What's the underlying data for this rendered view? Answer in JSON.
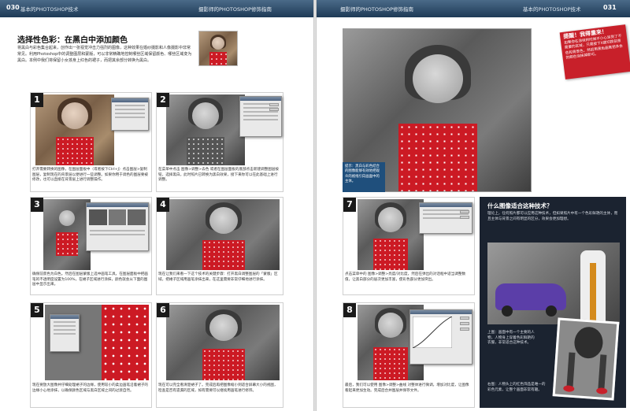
{
  "left_page": {
    "page_number": "030",
    "section": "基本的PHOTOSHOP技术",
    "running_title": "摄影师的PHOTOSHOP修饰指南",
    "title": "选择性色彩：在黑白中添加颜色",
    "intro": "将黑白与彩色集合起来，创作出一张视觉冲击力强烈的图像，这种效果在婚纱摄影和人像摄影中非常常见。利用Photoshop中的调整图层和蒙版，可以非常精确地控制哪些区域保留颜色、哪些区域变为黑白。本例中我们将保留小女孩身上红色的裙子，而把其余部分转换为黑白。",
    "steps": [
      {
        "n": "1",
        "text": "打开需要转换的图像，在图层面板中（或者按下Ctrl+J）点击图层>复制图层，复制现在的背景层以便进行一些调整。如果你用于调色的图层要被修改，也可以直接在背景层上进行调整操作。"
      },
      {
        "n": "2",
        "text": "在菜单中点击 图像>调整>去色 或者在图层面板的底部点击新建调整图层按钮，选择黑白。此时照片已转换为黑白效果，接下来你可以在此基础上进行调整。"
      },
      {
        "n": "3",
        "text": "确保前景色为白色。然后在图层蒙版上选中画笔工具，在图层面板中把画笔的不透明度设置为100%，在裙子区域进行涂抹，颜色就会从下面的图层中显示出来。"
      },
      {
        "n": "4",
        "text": "现在让我们来看一下这个技术的关键步骤：打开黑白调整图层的「蒙版」区域，把裙子区域用画笔涂抹出来，在这里需要非常仔细地进行涂抹。"
      },
      {
        "n": "5",
        "text": "现在要放大图像并仔细处理裙子的边缘，使用较小的柔边画笔沿着裙子的边缘小心地涂抹，以确保颜色区域与黑白区域之间的过渡自然。"
      },
      {
        "n": "6",
        "text": "现在可以完全看清楚裙子了。完成后再把图像缩小到适合屏幕大小的视图，检查是否有遗漏的区域，如有需要可以继续用画笔进行修饰。"
      }
    ]
  },
  "right_page": {
    "page_number": "031",
    "section": "基本的PHOTOSHOP技术",
    "running_title": "摄影师的PHOTOSHOP修饰指南",
    "warning_title": "提醒！我得重来！",
    "warning_text": "如果你在涂抹的时候不小心涂到了不需要的区域，只需按下X键切换前景色和背景色，然后用黑色画笔把多余的颜色涂抹掉即可。",
    "blue_note": "提示：黑白与彩色结合的图像能够有效地把观众的视线引向画面中的主体。",
    "steps": [
      {
        "n": "7",
        "text": "点击菜单中的 图像>调整>亮度/对比度，然后在弹出的对话框中适当调整数值，让黑白部分的层次更加丰富，使彩色部分更加突出。"
      },
      {
        "n": "8",
        "text": "最后，我们可以使用 图像>调整>曲线 对整体进行微调，增加对比度，让图像看起来更加生动。完成后合并图层并保存文件。"
      }
    ],
    "sidebar_title": "什么图像适合这种技术？",
    "sidebar_body": "理论上，任何照片都可以应用这种技术，但如果照片中有一个色彩鲜艳的主体，而且主体与背景之间有明显的区分，效果会更加理想。",
    "sidebar_caption_1": "上图：画面中有一个主要的人物，人物身上穿着色彩鲜艳的衣服，非常适合这种技术。",
    "sidebar_caption_2": "右图：人物头上的红色饰品是唯一的彩色元素，让整个画面非常有趣。"
  }
}
